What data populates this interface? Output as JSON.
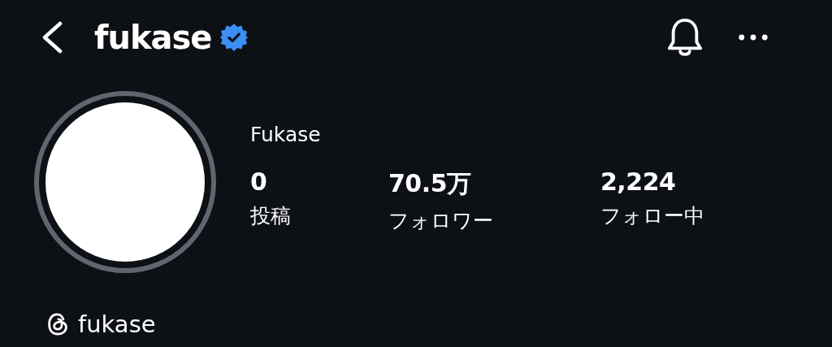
{
  "header": {
    "username": "fukase",
    "verified": true
  },
  "profile": {
    "name": "Fukase"
  },
  "stats": [
    {
      "value": "0",
      "label": "投稿"
    },
    {
      "value": "70.5万",
      "label": "フォロワー"
    },
    {
      "value": "2,224",
      "label": "フォロー中"
    }
  ],
  "threads_link": {
    "label": "fukase"
  }
}
